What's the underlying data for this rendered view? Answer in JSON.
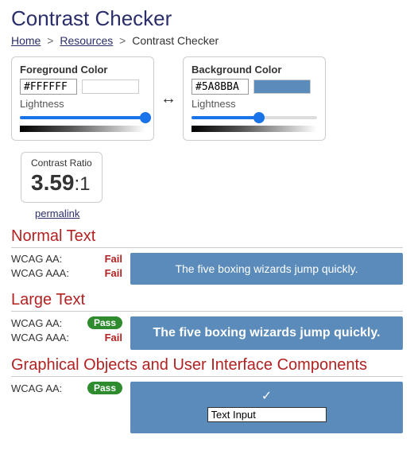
{
  "title": "Contrast Checker",
  "breadcrumb": {
    "home": "Home",
    "resources": "Resources",
    "current": "Contrast Checker",
    "sep": ">"
  },
  "foreground": {
    "label": "Foreground Color",
    "hex": "#FFFFFF",
    "swatch_color": "#FFFFFF",
    "lightness_label": "Lightness",
    "lightness_pct": 100
  },
  "background": {
    "label": "Background Color",
    "hex": "#5A8BBA",
    "swatch_color": "#5A8BBA",
    "lightness_label": "Lightness",
    "lightness_pct": 54
  },
  "swap_icon": "↔",
  "ratio": {
    "label": "Contrast Ratio",
    "value": "3.59",
    "suffix": ":1"
  },
  "permalink": "permalink",
  "sections": {
    "normal": {
      "title": "Normal Text",
      "aa_label": "WCAG AA:",
      "aa_result": "Fail",
      "aaa_label": "WCAG AAA:",
      "aaa_result": "Fail",
      "sample": "The five boxing wizards jump quickly."
    },
    "large": {
      "title": "Large Text",
      "aa_label": "WCAG AA:",
      "aa_result": "Pass",
      "aaa_label": "WCAG AAA:",
      "aaa_result": "Fail",
      "sample": "The five boxing wizards jump quickly."
    },
    "ui": {
      "title": "Graphical Objects and User Interface Components",
      "aa_label": "WCAG AA:",
      "aa_result": "Pass",
      "check": "✓",
      "input_value": "Text Input"
    }
  }
}
